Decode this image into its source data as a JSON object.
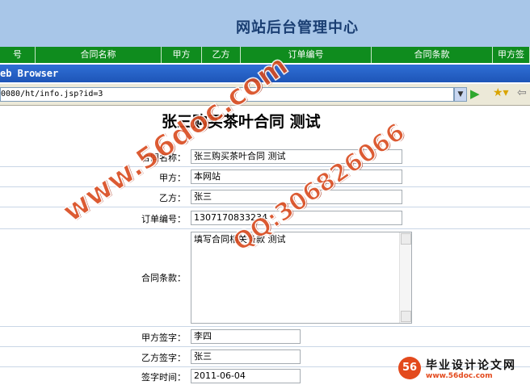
{
  "header": {
    "title": "网站后台管理中心"
  },
  "columns": [
    "号",
    "合同名称",
    "甲方",
    "乙方",
    "订单编号",
    "合同条款",
    "甲方签"
  ],
  "browser": {
    "title": "eb Browser",
    "url": "0080/ht/info.jsp?id=3"
  },
  "page": {
    "title": "张三购买茶叶合同 测试"
  },
  "form": {
    "contract_name": {
      "label": "合同名称：",
      "value": "张三购买茶叶合同 测试"
    },
    "party_a": {
      "label": "甲方：",
      "value": "本网站"
    },
    "party_b": {
      "label": "乙方：",
      "value": "张三"
    },
    "order_no": {
      "label": "订单编号：",
      "value": "13071708332­34"
    },
    "terms": {
      "label": "合同条款：",
      "value": "填写合同相关条款 测试"
    },
    "sign_a": {
      "label": "甲方签字：",
      "value": "李四"
    },
    "sign_b": {
      "label": "乙方签字：",
      "value": "张三"
    },
    "sign_date": {
      "label": "签字时间：",
      "value": "2011-06-04"
    }
  },
  "watermark": {
    "left": "www.56doc.com",
    "right": "QQ:306826066"
  },
  "logo": {
    "name": "毕业设计论文网",
    "url": "www.56doc.com",
    "mark": "56"
  }
}
